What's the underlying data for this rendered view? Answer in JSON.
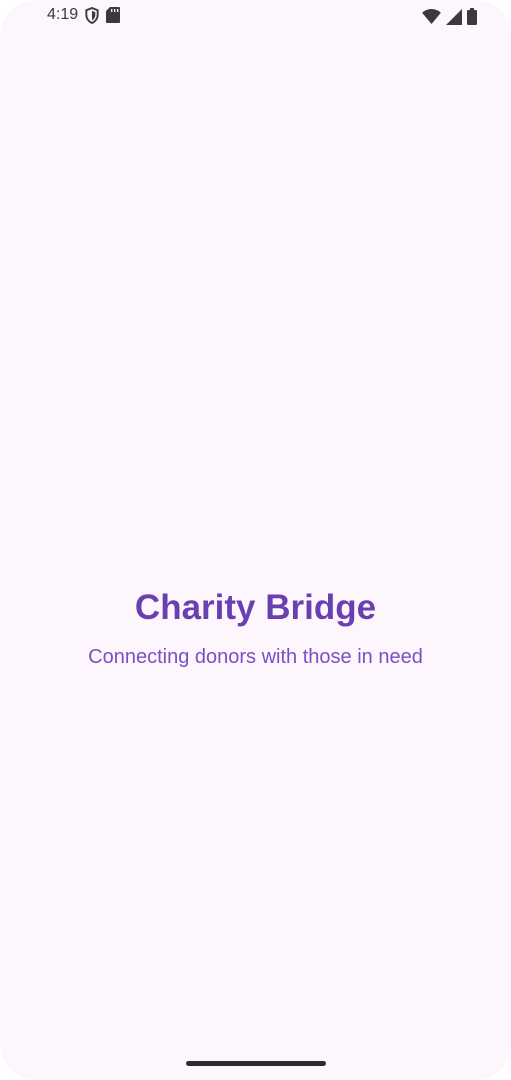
{
  "status_bar": {
    "time": "4:19",
    "icons_left": [
      "shield-icon",
      "sd-card-icon"
    ],
    "icons_right": [
      "wifi-icon",
      "cellular-signal-icon",
      "battery-icon"
    ]
  },
  "splash": {
    "title": "Charity Bridge",
    "tagline": "Connecting donors with those in need"
  },
  "colors": {
    "background": "#fdf6fd",
    "title": "#6a3fb0",
    "tagline": "#7a4fc4",
    "status_icons": "#3a3a3a"
  }
}
